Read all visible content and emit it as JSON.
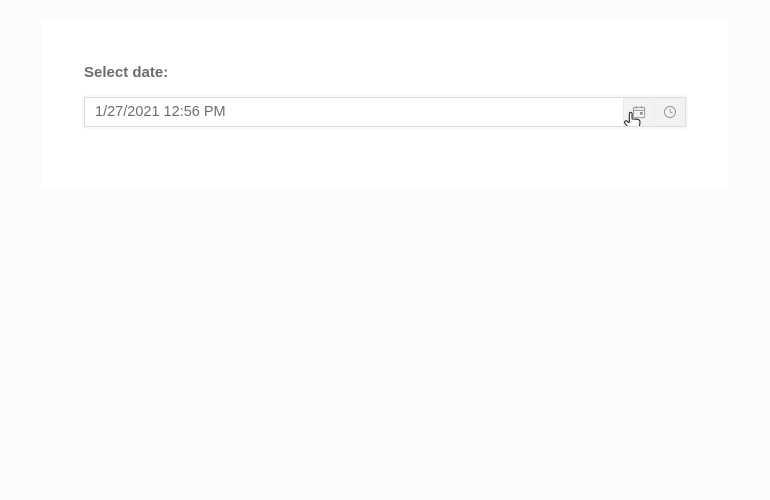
{
  "form": {
    "label": "Select date:",
    "datetime_value": "1/27/2021 12:56 PM"
  }
}
